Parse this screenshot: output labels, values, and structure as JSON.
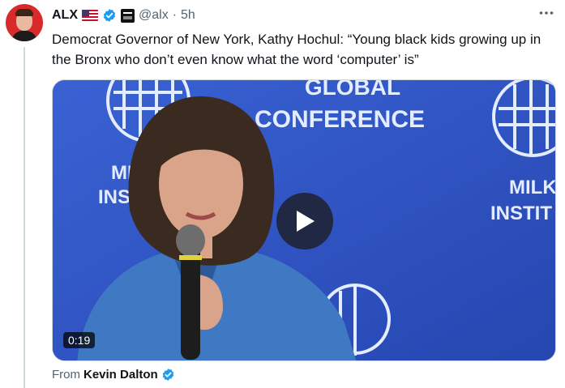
{
  "author": {
    "name": "ALX",
    "handle": "@alx",
    "separator": "·",
    "time": "5h",
    "flag_icon": "us-flag-icon",
    "verified_color": "#1d9bf0"
  },
  "tweet": {
    "text": "Democrat Governor of New York, Kathy Hochul: “Young black kids growing up in the Bronx who don’t even know what the word ‘computer’ is”"
  },
  "video": {
    "duration": "0:19",
    "backdrop": {
      "global": "GLOBAL",
      "conference": "CONFERENCE",
      "milken_left_1": "MIL",
      "milken_left_2": "INST",
      "milken_right_1": "MILK",
      "milken_right_2": "INSTIT"
    },
    "background_color": "#2e54c4"
  },
  "attribution": {
    "prefix": "From",
    "source": "Kevin Dalton"
  }
}
